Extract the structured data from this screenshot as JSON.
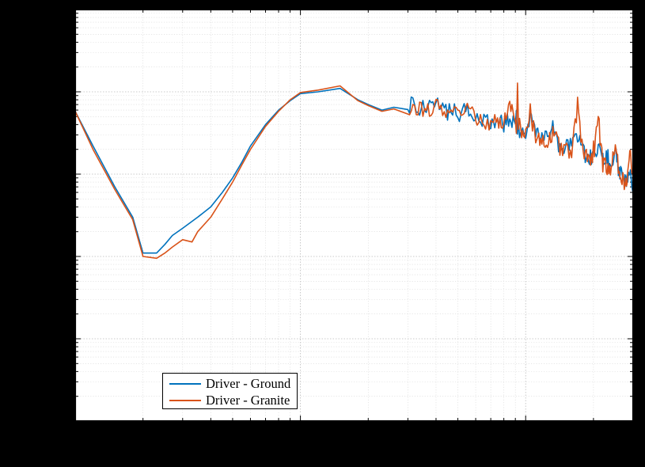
{
  "chart_data": {
    "type": "line",
    "title": "",
    "xlabel": "",
    "ylabel": "",
    "x_scale": "log",
    "y_scale": "log",
    "xlim": [
      10,
      3000
    ],
    "ylim": [
      0.01,
      1000
    ],
    "legend_position": "lower-left",
    "grid": true,
    "x_ticks_minor": [
      20,
      30,
      40,
      50,
      60,
      70,
      80,
      90,
      200,
      300,
      400,
      500,
      600,
      700,
      800,
      900,
      2000,
      3000
    ],
    "y_ticks_major": [
      0.01,
      0.1,
      1,
      10,
      100,
      1000
    ],
    "series": [
      {
        "name": "Driver - Ground",
        "color": "#0072BD",
        "x": [
          10,
          12,
          15,
          18,
          20,
          23,
          25,
          27,
          30,
          35,
          40,
          45,
          50,
          55,
          60,
          70,
          80,
          90,
          100,
          120,
          150,
          180,
          200,
          230,
          260,
          300,
          350,
          400,
          450,
          500,
          560,
          630,
          700,
          750,
          800,
          850,
          900,
          950,
          1000,
          1060,
          1120,
          1180,
          1250,
          1320,
          1400,
          1500,
          1600,
          1700,
          1800,
          1900,
          2000,
          2100,
          2200,
          2300,
          2400,
          2500,
          2600,
          2700,
          2800,
          2900,
          3000
        ],
        "y": [
          58,
          22,
          7,
          3,
          1.1,
          1.1,
          1.4,
          1.8,
          2.2,
          3,
          4,
          6,
          9,
          14,
          22,
          40,
          60,
          78,
          95,
          100,
          110,
          80,
          70,
          60,
          65,
          70,
          62,
          68,
          58,
          55,
          60,
          48,
          45,
          42,
          40,
          46,
          38,
          35,
          33,
          48,
          30,
          28,
          26,
          35,
          24,
          22,
          21,
          30,
          18,
          17,
          16,
          22,
          14,
          13,
          12,
          18,
          10,
          9.5,
          8,
          12,
          6
        ],
        "_noise_hint": "Values at x>300 are noisy/oscillatory; points above are a coarse envelope."
      },
      {
        "name": "Driver - Granite",
        "color": "#D95319",
        "x": [
          10,
          12,
          15,
          18,
          20,
          23,
          25,
          27,
          30,
          33,
          35,
          40,
          45,
          50,
          55,
          60,
          70,
          80,
          90,
          100,
          120,
          150,
          180,
          200,
          230,
          260,
          300,
          350,
          400,
          450,
          500,
          560,
          630,
          700,
          750,
          800,
          850,
          900,
          950,
          1000,
          1060,
          1120,
          1180,
          1250,
          1320,
          1400,
          1500,
          1600,
          1700,
          1800,
          1900,
          2000,
          2100,
          2200,
          2300,
          2400,
          2500,
          2600,
          2700,
          2800,
          2900,
          3000
        ],
        "y": [
          58,
          20,
          6.5,
          2.8,
          1.0,
          0.95,
          1.1,
          1.3,
          1.6,
          1.5,
          2.0,
          3,
          5,
          8,
          13,
          20,
          38,
          58,
          80,
          98,
          105,
          118,
          78,
          68,
          58,
          62,
          68,
          60,
          65,
          55,
          52,
          58,
          46,
          43,
          40,
          38,
          85,
          36,
          33,
          31,
          44,
          28,
          26,
          24,
          32,
          22,
          20,
          19,
          70,
          17,
          16,
          15,
          48,
          13,
          12,
          11,
          26,
          9,
          8.5,
          7.5,
          20,
          9
        ],
        "_noise_hint": "Values at x>300 are noisy/oscillatory with occasional tall spikes; points above are a coarse envelope."
      }
    ],
    "colors": {
      "ground": "#0072BD",
      "granite": "#D95319"
    }
  },
  "legend": {
    "items": [
      {
        "label": "Driver - Ground",
        "color": "#0072BD"
      },
      {
        "label": "Driver - Granite",
        "color": "#D95319"
      }
    ]
  }
}
